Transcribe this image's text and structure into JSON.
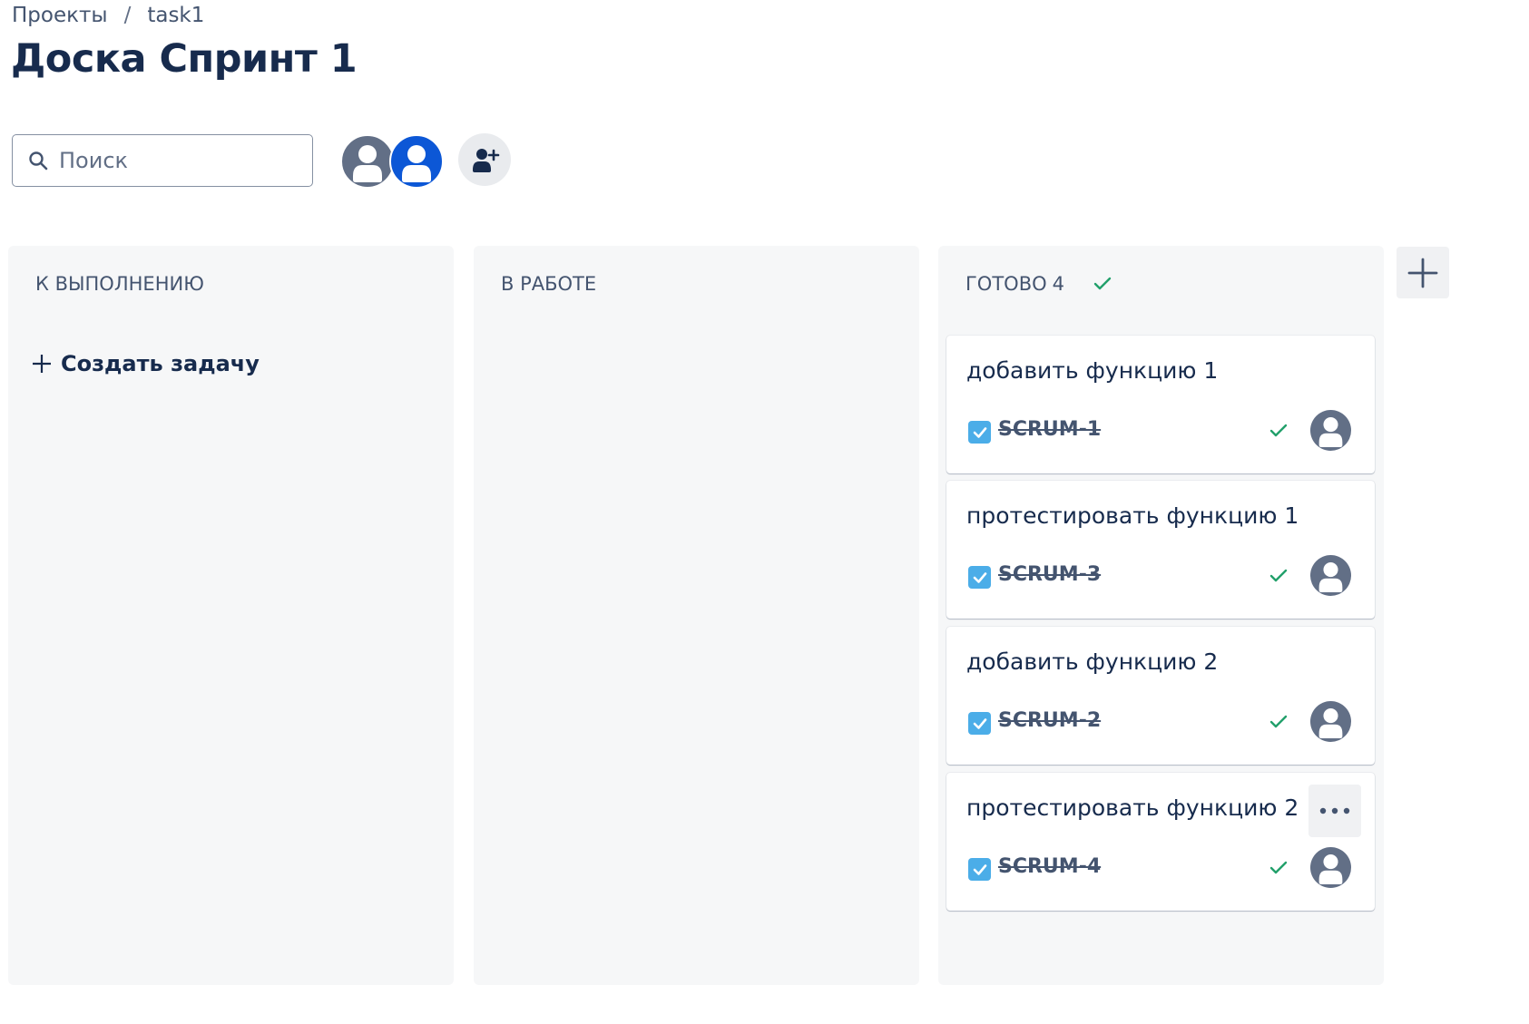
{
  "breadcrumb": {
    "items": [
      "Проекты",
      "task1"
    ],
    "separator": "/"
  },
  "page_title": "Доска Спринт 1",
  "search": {
    "placeholder": "Поиск",
    "value": ""
  },
  "avatars": [
    {
      "color": "#626f86",
      "icon": "user-icon"
    },
    {
      "color": "#0c57d6",
      "icon": "user-icon"
    }
  ],
  "add_people_icon": "add-person-icon",
  "columns": [
    {
      "title": "К ВЫПОЛНЕНИЮ",
      "count": "",
      "create_label": "Создать задачу"
    },
    {
      "title": "В РАБОТЕ",
      "count": ""
    },
    {
      "title": "ГОТОВО",
      "count": "4",
      "done_icon": "check-icon"
    }
  ],
  "cards": [
    {
      "title": "добавить функцию 1",
      "key": "SCRUM-1",
      "type_icon": "checkbox-icon",
      "done": true
    },
    {
      "title": "протестировать функцию 1",
      "key": "SCRUM-3",
      "type_icon": "checkbox-icon",
      "done": true
    },
    {
      "title": "добавить функцию 2",
      "key": "SCRUM-2",
      "type_icon": "checkbox-icon",
      "done": true
    },
    {
      "title": "протестировать функцию 2",
      "key": "SCRUM-4",
      "type_icon": "checkbox-icon",
      "done": true,
      "more_menu_visible": true
    }
  ],
  "colors": {
    "title": "#172b4d",
    "muted": "#44546f",
    "column_bg": "#f6f7f8",
    "done_green": "#22a06b",
    "task_blue": "#4bade8",
    "avatar_gray": "#626f86",
    "avatar_blue": "#0c57d6"
  }
}
